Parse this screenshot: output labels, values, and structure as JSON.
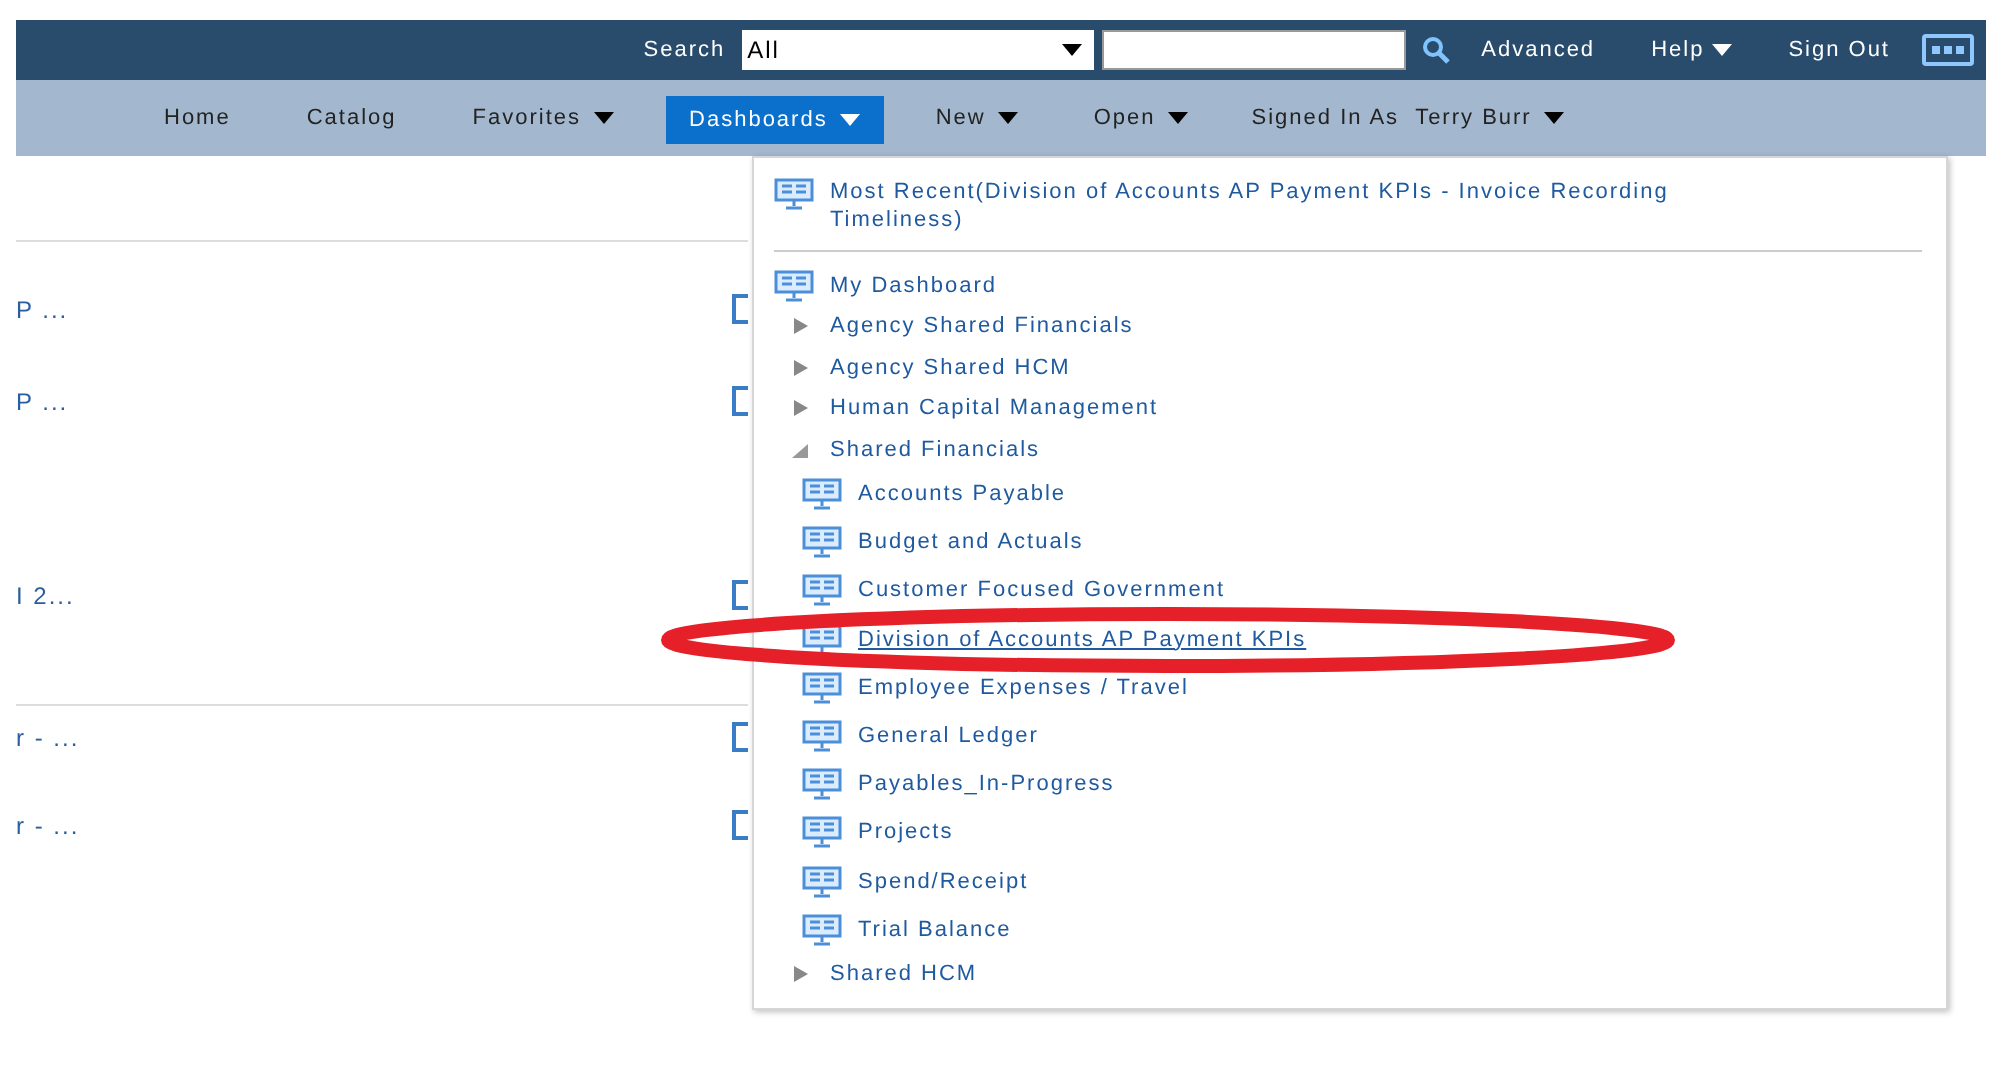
{
  "top_bar": {
    "search_label": "Search",
    "search_scope": "All",
    "advanced": "Advanced",
    "help": "Help",
    "sign_out": "Sign Out"
  },
  "nav": {
    "items": [
      {
        "label": "Home",
        "caret": false,
        "selected": false
      },
      {
        "label": "Catalog",
        "caret": false,
        "selected": false
      },
      {
        "label": "Favorites",
        "caret": true,
        "selected": false
      },
      {
        "label": "Dashboards",
        "caret": true,
        "selected": true
      },
      {
        "label": "New",
        "caret": true,
        "selected": false
      },
      {
        "label": "Open",
        "caret": true,
        "selected": false
      }
    ],
    "signed_in_label": "Signed In As",
    "user": "Terry Burr"
  },
  "background_rows": [
    {
      "text": "P ...",
      "divider_before": false
    },
    {
      "text": "P ...",
      "divider_before": false
    },
    {
      "text": "I 2...",
      "divider_before": false
    },
    {
      "text": "r - ...",
      "divider_before": true
    },
    {
      "text": "r - ...",
      "divider_before": false
    }
  ],
  "menu": {
    "most_recent": "Most Recent(Division of Accounts AP Payment KPIs - Invoice Recording Timeliness)",
    "items": [
      {
        "label": "My Dashboard",
        "kind": "dashboard",
        "selected": false
      },
      {
        "label": "Agency Shared Financials",
        "kind": "folder",
        "expanded": false
      },
      {
        "label": "Agency Shared HCM",
        "kind": "folder",
        "expanded": false
      },
      {
        "label": "Human Capital Management",
        "kind": "folder",
        "expanded": false
      },
      {
        "label": "Shared Financials",
        "kind": "folder",
        "expanded": true,
        "children": [
          {
            "label": "Accounts Payable",
            "kind": "dashboard",
            "selected": false
          },
          {
            "label": "Budget and Actuals",
            "kind": "dashboard",
            "selected": false
          },
          {
            "label": "Customer Focused Government",
            "kind": "dashboard",
            "selected": false
          },
          {
            "label": "Division of Accounts AP Payment KPIs",
            "kind": "dashboard",
            "selected": true
          },
          {
            "label": "Employee Expenses / Travel",
            "kind": "dashboard",
            "selected": false
          },
          {
            "label": "General Ledger",
            "kind": "dashboard",
            "selected": false
          },
          {
            "label": "Payables_In-Progress",
            "kind": "dashboard",
            "selected": false
          },
          {
            "label": "Projects",
            "kind": "dashboard",
            "selected": false
          },
          {
            "label": "Spend/Receipt",
            "kind": "dashboard",
            "selected": false
          },
          {
            "label": "Trial Balance",
            "kind": "dashboard",
            "selected": false
          }
        ]
      },
      {
        "label": "Shared HCM",
        "kind": "folder",
        "expanded": false
      }
    ]
  }
}
